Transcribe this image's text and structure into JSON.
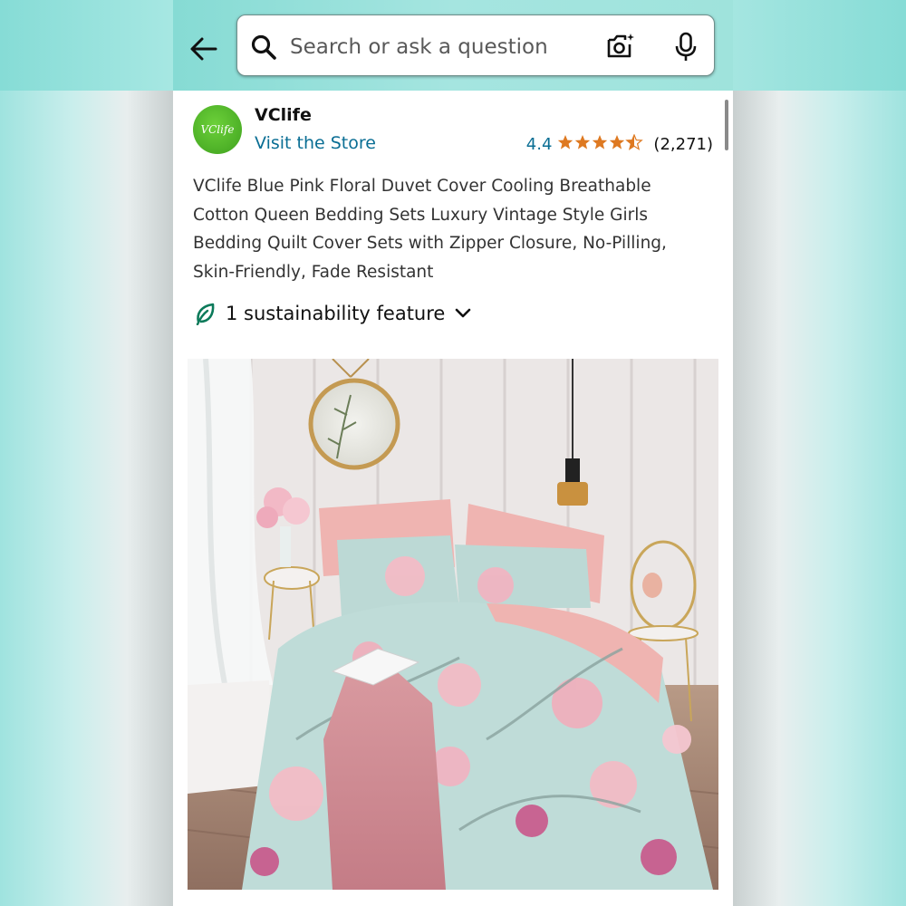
{
  "search": {
    "placeholder": "Search or ask a question",
    "back_icon": "arrow-left-icon",
    "search_icon": "magnifier-icon",
    "camera_icon": "camera-icon",
    "mic_icon": "microphone-icon"
  },
  "store": {
    "logo_text": "VClife",
    "brand": "VClife",
    "visit_label": "Visit the Store"
  },
  "rating": {
    "value": "4.4",
    "stars": "★★★★★",
    "count": "(2,271)"
  },
  "product": {
    "title": "VClife Blue Pink Floral Duvet Cover Cooling Breathable Cotton Queen Bedding Sets Luxury Vintage Style Girls Bedding Quilt Cover Sets with Zipper Closure, No-Pilling, Skin-Friendly, Fade Resistant"
  },
  "sustainability": {
    "label": "1 sustainability feature",
    "icon": "leaf-icon"
  },
  "colors": {
    "link": "#0a6e94",
    "star": "#de7921",
    "logo_green": "#4cb52a",
    "header_teal": "#9fe3dc"
  }
}
